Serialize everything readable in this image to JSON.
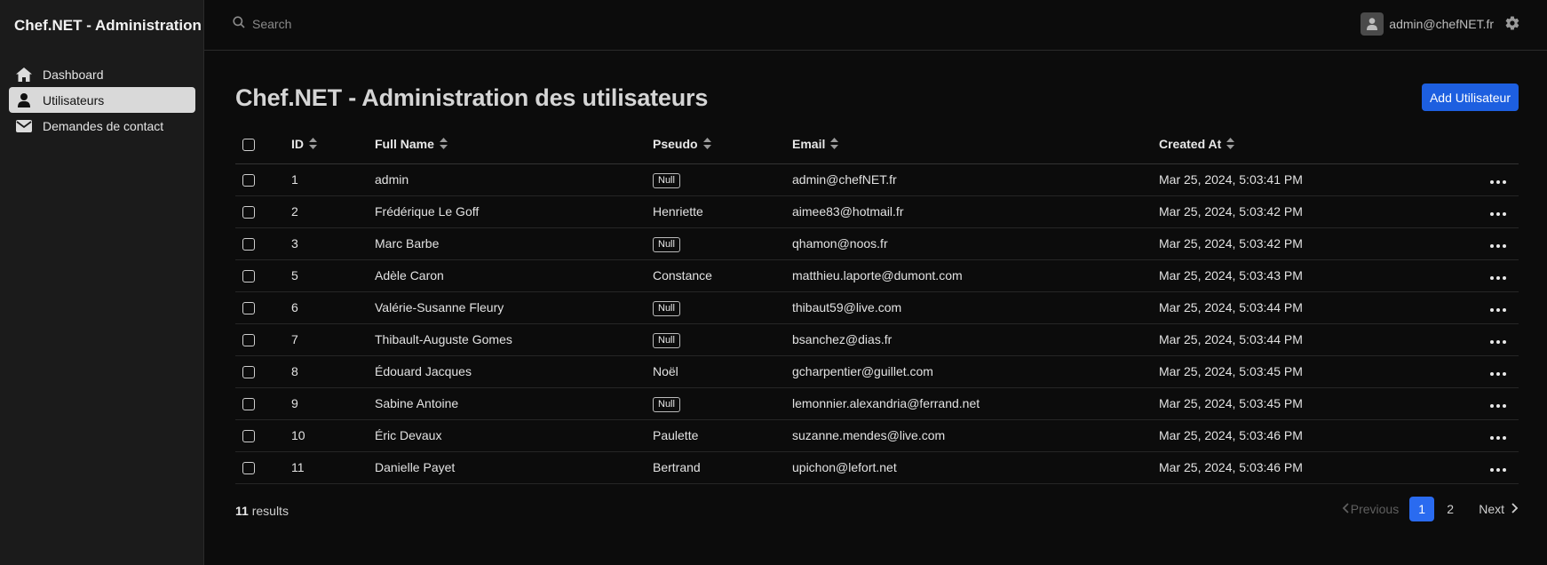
{
  "app": {
    "title": "Chef.NET - Administration"
  },
  "sidebar": {
    "items": [
      {
        "label": "Dashboard",
        "icon": "home-icon",
        "active": false
      },
      {
        "label": "Utilisateurs",
        "icon": "user-icon",
        "active": true
      },
      {
        "label": "Demandes de contact",
        "icon": "mail-icon",
        "active": false
      }
    ]
  },
  "topbar": {
    "search_placeholder": "Search",
    "user_email": "admin@chefNET.fr"
  },
  "page": {
    "title": "Chef.NET - Administration des utilisateurs",
    "add_button": "Add Utilisateur"
  },
  "table": {
    "columns": [
      "ID",
      "Full Name",
      "Pseudo",
      "Email",
      "Created At"
    ],
    "rows": [
      {
        "id": "1",
        "name": "admin",
        "pseudo": "Null",
        "email": "admin@chefNET.fr",
        "created": "Mar 25, 2024, 5:03:41 PM"
      },
      {
        "id": "2",
        "name": "Frédérique Le Goff",
        "pseudo": "Henriette",
        "email": "aimee83@hotmail.fr",
        "created": "Mar 25, 2024, 5:03:42 PM"
      },
      {
        "id": "3",
        "name": "Marc Barbe",
        "pseudo": "Null",
        "email": "qhamon@noos.fr",
        "created": "Mar 25, 2024, 5:03:42 PM"
      },
      {
        "id": "5",
        "name": "Adèle Caron",
        "pseudo": "Constance",
        "email": "matthieu.laporte@dumont.com",
        "created": "Mar 25, 2024, 5:03:43 PM"
      },
      {
        "id": "6",
        "name": "Valérie-Susanne Fleury",
        "pseudo": "Null",
        "email": "thibaut59@live.com",
        "created": "Mar 25, 2024, 5:03:44 PM"
      },
      {
        "id": "7",
        "name": "Thibault-Auguste Gomes",
        "pseudo": "Null",
        "email": "bsanchez@dias.fr",
        "created": "Mar 25, 2024, 5:03:44 PM"
      },
      {
        "id": "8",
        "name": "Édouard Jacques",
        "pseudo": "Noël",
        "email": "gcharpentier@guillet.com",
        "created": "Mar 25, 2024, 5:03:45 PM"
      },
      {
        "id": "9",
        "name": "Sabine Antoine",
        "pseudo": "Null",
        "email": "lemonnier.alexandria@ferrand.net",
        "created": "Mar 25, 2024, 5:03:45 PM"
      },
      {
        "id": "10",
        "name": "Éric Devaux",
        "pseudo": "Paulette",
        "email": "suzanne.mendes@live.com",
        "created": "Mar 25, 2024, 5:03:46 PM"
      },
      {
        "id": "11",
        "name": "Danielle Payet",
        "pseudo": "Bertrand",
        "email": "upichon@lefort.net",
        "created": "Mar 25, 2024, 5:03:46 PM"
      }
    ]
  },
  "footer": {
    "results_count": "11",
    "results_label": "results",
    "prev_label": "Previous",
    "next_label": "Next",
    "pages": [
      "1",
      "2"
    ],
    "current_page": "1"
  },
  "colors": {
    "accent": "#1d5fe0",
    "page_active": "#2a6bf0",
    "sidebar_bg": "#1b1b1b",
    "background": "#0c0c0c"
  }
}
